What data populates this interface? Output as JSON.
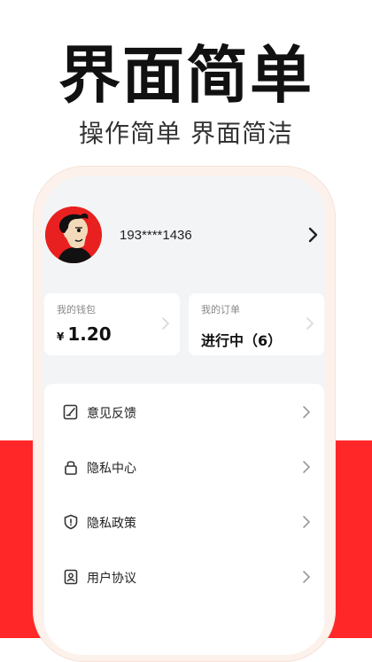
{
  "headline": "界面简单",
  "subheadline": "操作简单 界面简洁",
  "profile": {
    "phone": "193****1436"
  },
  "wallet": {
    "label": "我的钱包",
    "currency": "¥",
    "amount": "1.20"
  },
  "orders": {
    "label": "我的订单",
    "status": "进行中（6）"
  },
  "menu": [
    {
      "label": "意见反馈",
      "icon": "feedback-icon"
    },
    {
      "label": "隐私中心",
      "icon": "lock-icon"
    },
    {
      "label": "隐私政策",
      "icon": "shield-icon"
    },
    {
      "label": "用户协议",
      "icon": "user-agreement-icon"
    }
  ],
  "colors": {
    "brand_red": "#ff2727",
    "avatar_red": "#e8201f",
    "frame_peach": "#fdf1ec",
    "screen_gray": "#f3f4f6"
  }
}
